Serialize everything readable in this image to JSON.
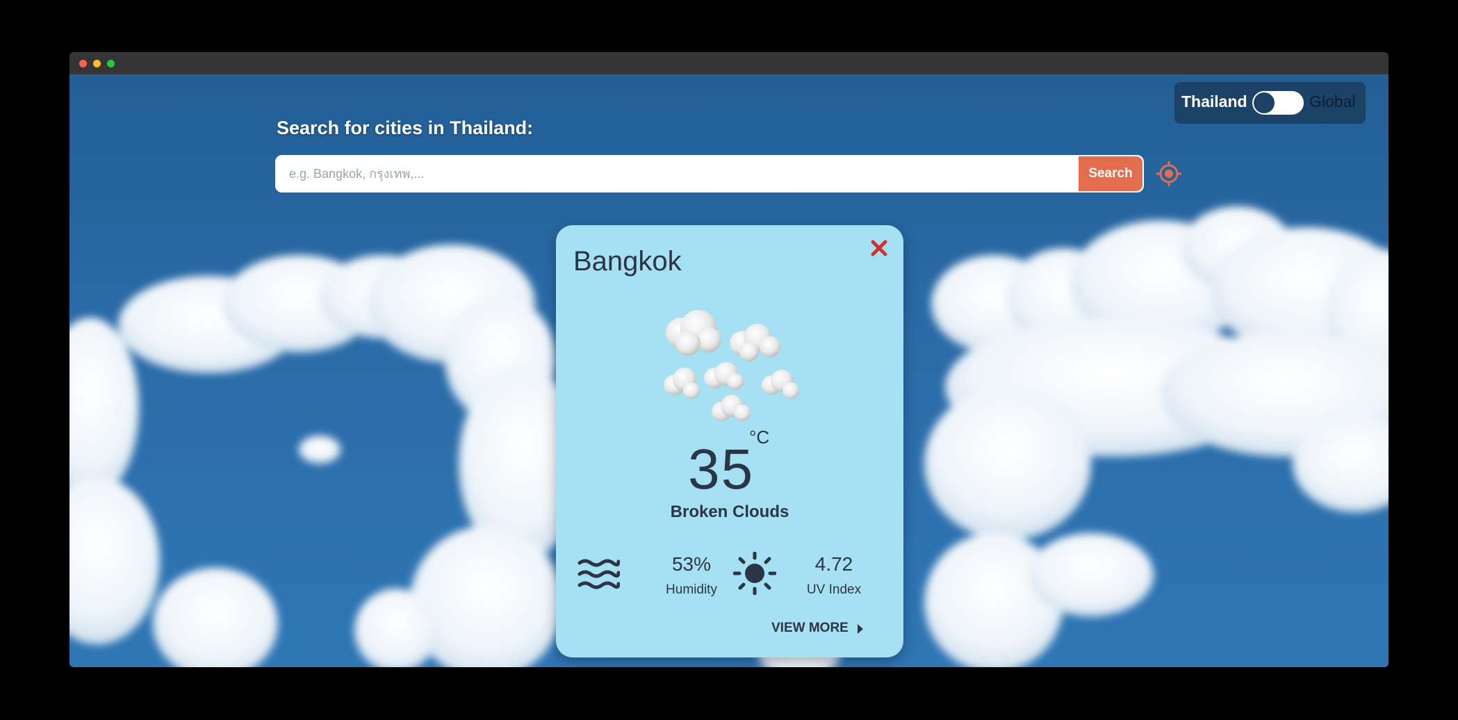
{
  "toggle": {
    "left_label": "Thailand",
    "right_label": "Global"
  },
  "search": {
    "title": "Search for cities in Thailand:",
    "placeholder": "e.g. Bangkok, กรุงเทพ,...",
    "button_label": "Search"
  },
  "card": {
    "city": "Bangkok",
    "temperature": "35",
    "unit": "°C",
    "description": "Broken Clouds",
    "humidity": {
      "value": "53%",
      "label": "Humidity"
    },
    "uv": {
      "value": "4.72",
      "label": "UV Index"
    },
    "view_more": "VIEW MORE"
  },
  "colors": {
    "accent": "#e36d4f",
    "card_bg": "#a6e0f3",
    "dark": "#1d4268",
    "close": "#d32f2f"
  }
}
